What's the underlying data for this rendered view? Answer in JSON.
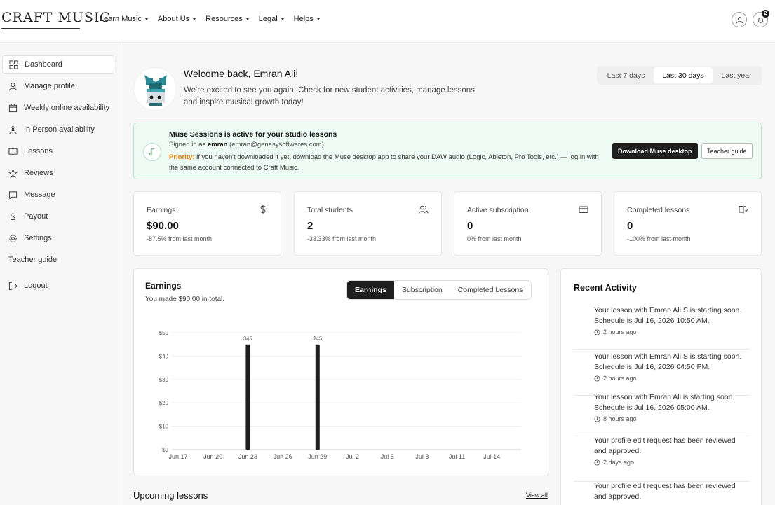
{
  "header": {
    "logo": "CRAFT MUSIC",
    "nav": [
      "Learn Music",
      "About Us",
      "Resources",
      "Legal",
      "Helps"
    ],
    "notification_count": "2"
  },
  "sidebar": {
    "items": [
      {
        "label": "Dashboard",
        "icon": "grid-icon",
        "active": true
      },
      {
        "label": "Manage profile",
        "icon": "user-icon"
      },
      {
        "label": "Weekly online availability",
        "icon": "calendar-icon"
      },
      {
        "label": "In Person availability",
        "icon": "user-pin-icon"
      },
      {
        "label": "Lessons",
        "icon": "book-open-icon"
      },
      {
        "label": "Reviews",
        "icon": "star-icon"
      },
      {
        "label": "Message",
        "icon": "message-icon"
      },
      {
        "label": "Payout",
        "icon": "dollar-icon"
      },
      {
        "label": "Settings",
        "icon": "gear-icon"
      },
      {
        "label": "Teacher guide",
        "icon": ""
      },
      {
        "label": "Logout",
        "icon": "logout-icon"
      }
    ]
  },
  "welcome": {
    "title": "Welcome back, Emran Ali!",
    "subtitle": "We're excited to see you again. Check for new student activities, manage lessons, and inspire musical growth today!"
  },
  "range": {
    "options": [
      "Last 7 days",
      "Last 30 days",
      "Last year"
    ],
    "selected": "Last 30 days"
  },
  "muse": {
    "title": "Muse Sessions is active for your studio lessons",
    "signed_prefix": "Signed in as",
    "username": "emran",
    "email": "(emran@genesysoftwares.com)",
    "priority_label": "Priority:",
    "priority_text": "if you haven't downloaded it yet, download the Muse desktop app to share your DAW audio (Logic, Ableton, Pro Tools, etc.) — log in with the same account connected to Craft Music.",
    "download_button": "Download Muse desktop",
    "guide_button": "Teacher guide"
  },
  "stats": [
    {
      "label": "Earnings",
      "value": "$90.00",
      "change": "-87.5% from last month",
      "icon": "dollar-icon"
    },
    {
      "label": "Total students",
      "value": "2",
      "change": "-33.33% from last month",
      "icon": "users-icon"
    },
    {
      "label": "Active subscription",
      "value": "0",
      "change": "0% from last month",
      "icon": "credit-card-icon"
    },
    {
      "label": "Completed lessons",
      "value": "0",
      "change": "-100% from last month",
      "icon": "book-check-icon"
    }
  ],
  "earnings": {
    "title": "Earnings",
    "subtitle": "You made $90.00 in total.",
    "tabs": [
      "Earnings",
      "Subscription",
      "Completed Lessons"
    ],
    "active_tab": "Earnings"
  },
  "chart_data": {
    "type": "bar",
    "x_ticks": [
      "Jun 17",
      "Jun 20",
      "Jun 23",
      "Jun 26",
      "Jun 29",
      "Jul 2",
      "Jul 5",
      "Jul 8",
      "Jul 11",
      "Jul 14"
    ],
    "y_ticks": [
      "$0",
      "$10",
      "$20",
      "$30",
      "$40",
      "$50"
    ],
    "ylim": [
      0,
      50
    ],
    "bars": [
      {
        "date": "Jun 23",
        "value": 45,
        "label": "$45"
      },
      {
        "date": "Jun 29",
        "value": 45,
        "label": "$45"
      }
    ],
    "grid": true,
    "bar_color": "#1f1f1f"
  },
  "activity": {
    "title": "Recent Activity",
    "items": [
      {
        "text": "Your lesson with Emran Ali S is starting soon. Schedule is Jul 16, 2026 10:50 AM.",
        "time": "2 hours ago"
      },
      {
        "text": "Your lesson with Emran Ali S is starting soon. Schedule is Jul 16, 2026 04:50 PM.",
        "time": "2 hours ago"
      },
      {
        "text": "Your lesson with Emran Ali is starting soon. Schedule is Jul 16, 2026 05:00 AM.",
        "time": "8 hours ago"
      },
      {
        "text": "Your profile edit request has been reviewed and approved.",
        "time": "2 days ago"
      },
      {
        "text": "Your profile edit request has been reviewed and approved.",
        "time": ""
      }
    ]
  },
  "upcoming": {
    "title": "Upcoming lessons",
    "view_all": "View all"
  }
}
